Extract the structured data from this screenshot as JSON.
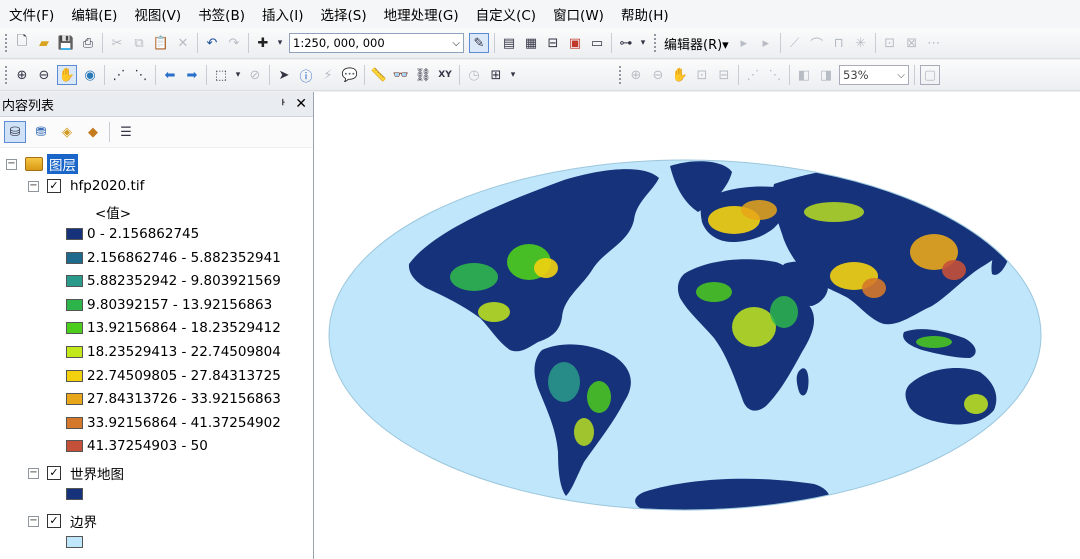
{
  "menu": [
    "文件(F)",
    "编辑(E)",
    "视图(V)",
    "书签(B)",
    "插入(I)",
    "选择(S)",
    "地理处理(G)",
    "自定义(C)",
    "窗口(W)",
    "帮助(H)"
  ],
  "toolbar": {
    "scale": "1:250, 000, 000",
    "editor_label": "编辑器(R)▾",
    "zoom_level": "53%"
  },
  "toc": {
    "title": "内容列表",
    "pin_glyph": "ᅡ",
    "close_glyph": "✕",
    "root_layer": "图层",
    "layers": [
      {
        "name": "hfp2020.tif",
        "field": "<值>",
        "classes": [
          {
            "label": "0 - 2.156862745",
            "color": "#16327a"
          },
          {
            "label": "2.156862746 - 5.882352941",
            "color": "#1e6a8c"
          },
          {
            "label": "5.882352942 - 9.803921569",
            "color": "#2a9b8a"
          },
          {
            "label": "9.80392157 - 13.92156863",
            "color": "#2db54c"
          },
          {
            "label": "13.92156864 - 18.23529412",
            "color": "#4ccc1d"
          },
          {
            "label": "18.23529413 - 22.74509804",
            "color": "#c2e81b"
          },
          {
            "label": "22.74509805 - 27.84313725",
            "color": "#f2d20f"
          },
          {
            "label": "27.84313726 - 33.92156863",
            "color": "#e8a61a"
          },
          {
            "label": "33.92156864 - 41.37254902",
            "color": "#d4782b"
          },
          {
            "label": "41.37254903 - 50",
            "color": "#c4503a"
          }
        ]
      },
      {
        "name": "世界地图",
        "swatch_color": "#16327a"
      },
      {
        "name": "边界",
        "swatch_color": "#bfe6fa"
      }
    ]
  },
  "map": {
    "ocean_color": "#bfe6fa",
    "land_color": "#16327a"
  }
}
